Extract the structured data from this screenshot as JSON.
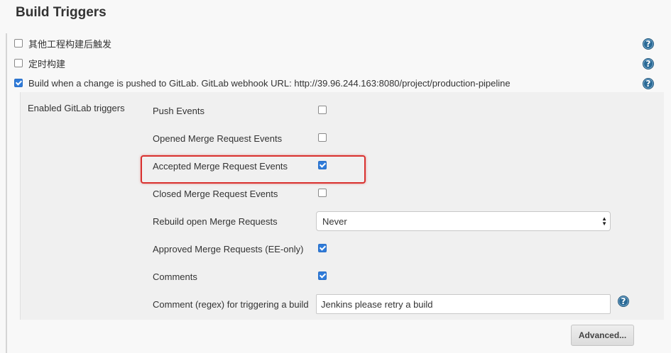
{
  "section": {
    "title": "Build Triggers"
  },
  "top_options": [
    {
      "label": "其他工程构建后触发",
      "checked": false
    },
    {
      "label": "定时构建",
      "checked": false
    },
    {
      "label": "Build when a change is pushed to GitLab. GitLab webhook URL: http://39.96.244.163:8080/project/production-pipeline",
      "checked": true
    }
  ],
  "gitlab": {
    "label": "Enabled GitLab triggers",
    "triggers": [
      {
        "label": "Push Events",
        "checked": false
      },
      {
        "label": "Opened Merge Request Events",
        "checked": false
      },
      {
        "label": "Accepted Merge Request Events",
        "checked": true
      },
      {
        "label": "Closed Merge Request Events",
        "checked": false
      }
    ],
    "rebuild": {
      "label": "Rebuild open Merge Requests",
      "value": "Never"
    },
    "approved": {
      "label": "Approved Merge Requests (EE-only)",
      "checked": true
    },
    "comments": {
      "label": "Comments",
      "checked": true
    },
    "comment_regex": {
      "label": "Comment (regex) for triggering a build",
      "value": "Jenkins please retry a build"
    },
    "advanced_label": "Advanced..."
  },
  "help_glyph": "?",
  "colors": {
    "checkbox_checked": "#2f7bd9",
    "highlight": "#d9312f",
    "help_icon": "#2b6a96"
  }
}
